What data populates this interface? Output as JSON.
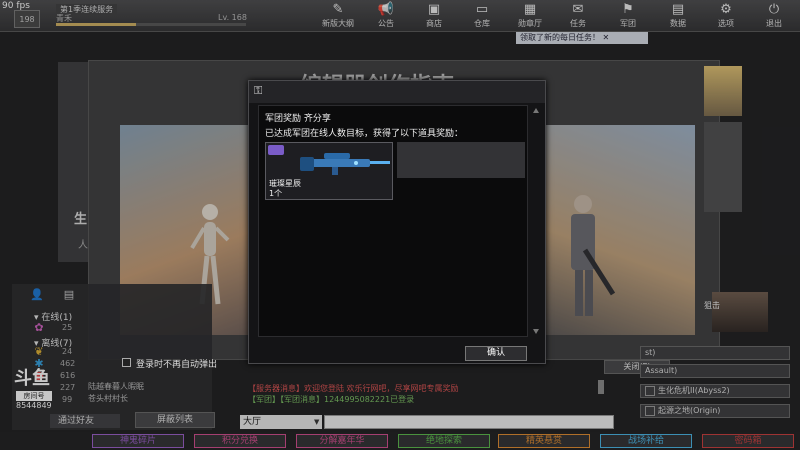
{
  "fps": "90 fps",
  "player": {
    "season_title": "第1季连续服务",
    "name": "青禾",
    "level": "Lv. 168",
    "rank_badge": "198",
    "exp_progress": 0.42
  },
  "nav": [
    {
      "label": "新版大纲",
      "icon": "✎"
    },
    {
      "label": "公告",
      "icon": "📢"
    },
    {
      "label": "商店",
      "icon": "▣"
    },
    {
      "label": "仓库",
      "icon": "▭"
    },
    {
      "label": "勋章厅",
      "icon": "▦"
    },
    {
      "label": "任务",
      "icon": "✉"
    },
    {
      "label": "军团",
      "icon": "⚑"
    },
    {
      "label": "数据",
      "icon": "▤"
    },
    {
      "label": "选项",
      "icon": "⚙"
    },
    {
      "label": "退出",
      "icon": "⏻"
    }
  ],
  "task_tip": "领取了新的每日任务！",
  "background": {
    "title": "编辑器创作指南",
    "left_text1": "生",
    "left_text2": "人"
  },
  "friends": {
    "online_label": "在线",
    "online_count": "(1)",
    "offline_label": "离线",
    "offline_count": "(7)",
    "levels": [
      "25",
      "24",
      "462",
      "616",
      "227",
      "99"
    ],
    "row1": "陆越春暮人暇眠",
    "row2": "苍头村村长",
    "add_friend": "通过好友",
    "block_list": "屏蔽列表"
  },
  "douyu": {
    "logo": "斗鱼",
    "tag": "房间号",
    "room": "8544849"
  },
  "help": "帮助",
  "chat": {
    "line1": "【服务器消息】欢迎您登陆 欢乐行网吧，尽享网吧专属奖励",
    "line2": "【军团】【军团消息】1244995082221已登录",
    "channel": "大厅",
    "input_value": ""
  },
  "right_panel": {
    "tag": "狙击",
    "close_label": "关闭(E)",
    "items": [
      {
        "label": "st)"
      },
      {
        "label": "Assault)"
      },
      {
        "label": "生化危机II(Abyss2)"
      },
      {
        "label": "起源之地(Origin)"
      }
    ]
  },
  "bottom": [
    {
      "label": "神鬼碎片",
      "color": "#9a5cc8"
    },
    {
      "label": "积分兑换",
      "color": "#d24a8c"
    },
    {
      "label": "分解嘉年华",
      "color": "#d24a8c"
    },
    {
      "label": "绝地探索",
      "color": "#58b848"
    },
    {
      "label": "精英悬赏",
      "color": "#e08a2c"
    },
    {
      "label": "战场补给",
      "color": "#46b4e6"
    },
    {
      "label": "密码箱",
      "color": "#c83a3a"
    }
  ],
  "dialog": {
    "title": "军团奖励 齐分享",
    "message": "已达成军团在线人数目标，获得了以下道具奖励：",
    "reward_name": "璀璨星辰",
    "reward_qty": "1个",
    "confirm_label": "确认",
    "noshow_label": "登录时不再自动弹出",
    "noshow_checked": false
  }
}
